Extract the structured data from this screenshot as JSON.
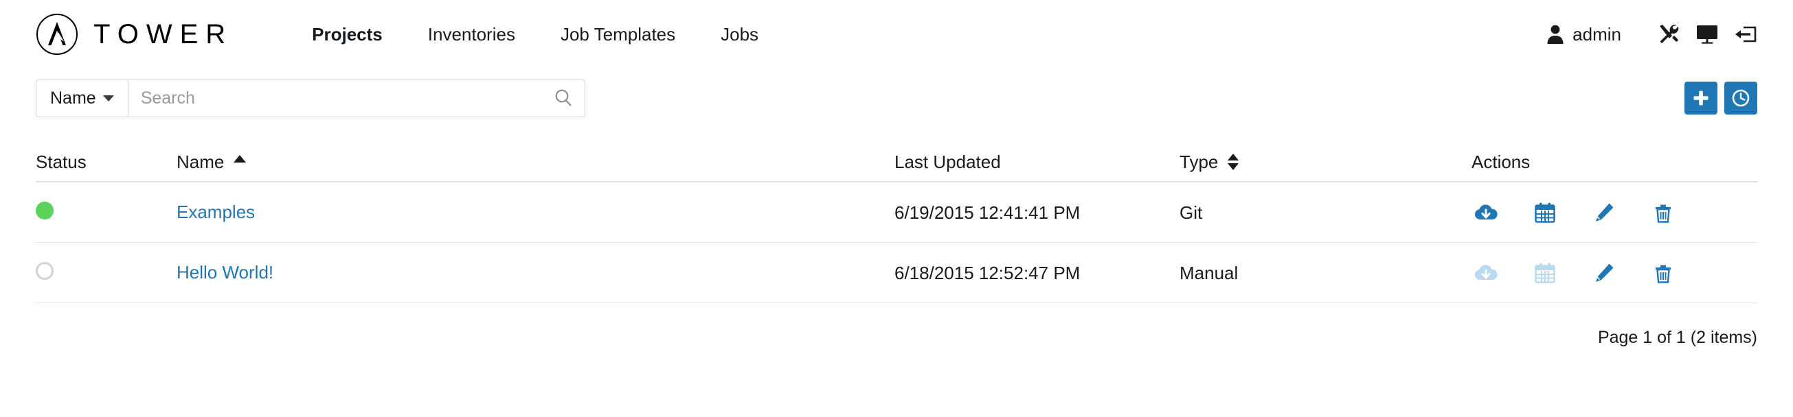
{
  "header": {
    "logo_icon": "ansible-a-logo-icon",
    "brand": "TOWER",
    "nav": [
      {
        "label": "Projects",
        "active": true
      },
      {
        "label": "Inventories",
        "active": false
      },
      {
        "label": "Job Templates",
        "active": false
      },
      {
        "label": "Jobs",
        "active": false
      }
    ],
    "user": {
      "icon": "user-icon",
      "name": "admin"
    },
    "icons": [
      {
        "name": "tools-icon"
      },
      {
        "name": "monitor-icon"
      },
      {
        "name": "logout-icon"
      }
    ]
  },
  "toolbar": {
    "search_key": "Name",
    "search_placeholder": "Search",
    "search_value": "",
    "search_icon": "search-icon",
    "add_icon": "plus-icon",
    "schedule_icon": "clock-icon"
  },
  "table": {
    "columns": [
      {
        "label": "Status",
        "sort": "none"
      },
      {
        "label": "Name",
        "sort": "asc"
      },
      {
        "label": "Last Updated",
        "sort": "none"
      },
      {
        "label": "Type",
        "sort": "both"
      },
      {
        "label": "Actions",
        "sort": "none"
      }
    ],
    "rows": [
      {
        "status": "ok",
        "name": "Examples",
        "last_updated": "6/19/2015 12:41:41 PM",
        "type": "Git",
        "actions": [
          {
            "name": "cloud-download-icon",
            "enabled": true
          },
          {
            "name": "calendar-icon",
            "enabled": true
          },
          {
            "name": "pencil-icon",
            "enabled": true
          },
          {
            "name": "trash-icon",
            "enabled": true
          }
        ]
      },
      {
        "status": "idle",
        "name": "Hello World!",
        "last_updated": "6/18/2015 12:52:47 PM",
        "type": "Manual",
        "actions": [
          {
            "name": "cloud-download-icon",
            "enabled": false
          },
          {
            "name": "calendar-icon",
            "enabled": false
          },
          {
            "name": "pencil-icon",
            "enabled": true
          },
          {
            "name": "trash-icon",
            "enabled": true
          }
        ]
      }
    ]
  },
  "pagination": {
    "text": "Page 1 of 1 (2 items)"
  },
  "colors": {
    "accent": "#2077b6",
    "link": "#2077b6",
    "status_ok": "#5ad45a",
    "status_idle": "#d3d3d3",
    "text": "#161b1f"
  }
}
